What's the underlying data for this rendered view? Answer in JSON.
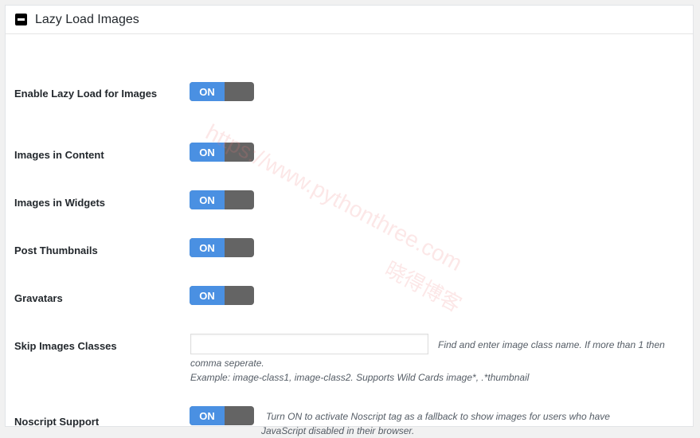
{
  "panel": {
    "title": "Lazy Load Images",
    "collapse_icon": "minus-square-icon"
  },
  "settings": [
    {
      "label": "Enable Lazy Load for Images",
      "state": "ON"
    },
    {
      "label": "Images in Content",
      "state": "ON"
    },
    {
      "label": "Images in Widgets",
      "state": "ON"
    },
    {
      "label": "Post Thumbnails",
      "state": "ON"
    },
    {
      "label": "Gravatars",
      "state": "ON"
    }
  ],
  "skip_classes": {
    "label": "Skip Images Classes",
    "value": "",
    "placeholder": "",
    "help_line1": "Find and enter image class name. If more than 1 then",
    "help_line2": "comma seperate.",
    "help_line3": "Example: image-class1, image-class2. Supports Wild Cards image*, .*thumbnail"
  },
  "noscript": {
    "label": "Noscript Support",
    "state": "ON",
    "help_line1": "Turn ON to activate Noscript tag as a fallback to show images for users who have",
    "help_line2": "JavaScript disabled in their browser."
  },
  "watermark": {
    "url": "https://www.pythonthree.com",
    "brand": "晓得博客"
  }
}
